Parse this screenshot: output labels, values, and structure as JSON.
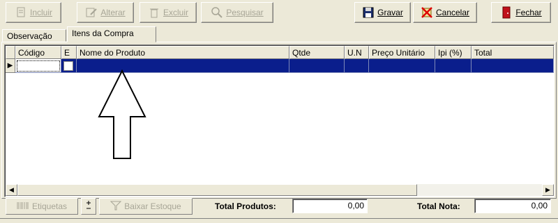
{
  "toolbar": {
    "incluir": "Incluir",
    "alterar": "Alterar",
    "excluir": "Excluir",
    "pesquisar": "Pesquisar",
    "gravar": "Gravar",
    "cancelar": "Cancelar",
    "fechar": "Fechar"
  },
  "tabs": {
    "observacao": "Observação",
    "itens": "Itens da Compra"
  },
  "grid": {
    "columns": [
      "Código",
      "E",
      "Nome do Produto",
      "Qtde",
      "U.N",
      "Preço Unitário",
      "Ipi (%)",
      "Total"
    ],
    "row_indicator": "▶"
  },
  "bottom": {
    "etiquetas": "Etiquetas",
    "baixar_estoque": "Baixar Estoque",
    "total_produtos_label": "Total Produtos:",
    "total_produtos_value": "0,00",
    "total_nota_label": "Total Nota:",
    "total_nota_value": "0,00"
  },
  "colors": {
    "selection": "#0a1e8c",
    "face": "#ece9d8"
  }
}
